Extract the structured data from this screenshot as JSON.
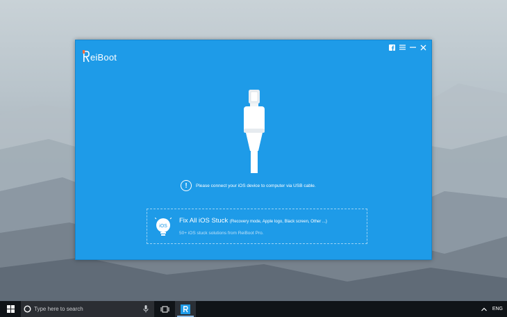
{
  "app": {
    "name": "ReiBoot",
    "logo_letter": "R",
    "logo_rest": "eiBoot",
    "title_controls": [
      "facebook-icon",
      "menu-icon",
      "minimize-icon",
      "close-icon"
    ]
  },
  "main": {
    "notice": "Please connect your iOS device to computer via USB cable.",
    "fix": {
      "badge": "iOS",
      "title": "Fix All iOS Stuck",
      "subtitle": "(Recovery mode, Apple logo, Black screen, Other ...)",
      "description": "50+ iOS stuck solutions from ReiBoot Pro."
    }
  },
  "taskbar": {
    "search_placeholder": "Type here to search",
    "language": "ENG"
  },
  "colors": {
    "window_bg": "#1e9be8",
    "taskbar_bg": "#101418",
    "accent": "#ffffff"
  }
}
